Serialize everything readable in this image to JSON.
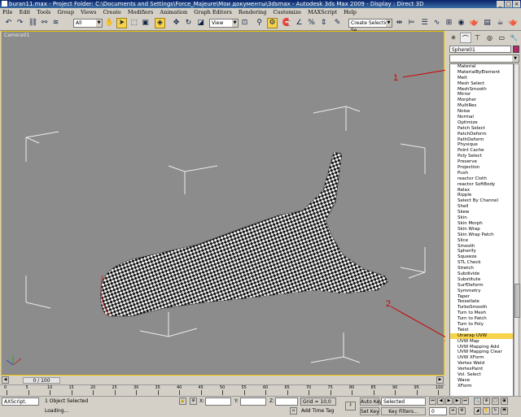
{
  "window": {
    "title": "buran11.max   - Project Folder: C:\\Documents and Settings\\Force_Majeure\\Мои документы\\3dsmax   - Autodesk 3ds Max  2009      - Display : Direct 3D",
    "controls": [
      "_",
      "□",
      "×"
    ]
  },
  "menu": [
    "File",
    "Edit",
    "Tools",
    "Group",
    "Views",
    "Create",
    "Modifiers",
    "Animation",
    "Graph Editors",
    "Rendering",
    "Customize",
    "MAXScript",
    "Help"
  ],
  "toolbar": {
    "selection_filter": "All",
    "reference_coord": "View",
    "named_selection_placeholder": "Create Selection Se"
  },
  "viewport": {
    "label": "Camera01",
    "callouts": [
      "1",
      "2"
    ],
    "colors": {
      "background": "#8c8c8c",
      "active_border": "#e8c000",
      "annotation": "#cc0000"
    }
  },
  "command_panel": {
    "tabs": [
      "create-icon",
      "modify-icon",
      "hierarchy-icon",
      "motion-icon",
      "display-icon",
      "utilities-icon"
    ],
    "object_name": "Sphere01",
    "object_color": "#b0286a",
    "modifiers": [
      "Material",
      "MaterialByElement",
      "Melt",
      "Mesh Select",
      "MeshSmooth",
      "Mirror",
      "Morpher",
      "MultiRes",
      "Noise",
      "Normal",
      "Optimize",
      "Patch Select",
      "PatchDeform",
      "PathDeform",
      "Physique",
      "Point Cache",
      "Poly Select",
      "Preserve",
      "Projection",
      "Push",
      "reactor Cloth",
      "reactor SoftBody",
      "Relax",
      "Ripple",
      "Select By Channel",
      "Shell",
      "Skew",
      "Skin",
      "Skin Morph",
      "Skin Wrap",
      "Skin Wrap Patch",
      "Slice",
      "Smooth",
      "Spherify",
      "Squeeze",
      "STL Check",
      "Stretch",
      "Subdivide",
      "Substitute",
      "SurfDeform",
      "Symmetry",
      "Taper",
      "Tessellate",
      "TurboSmooth",
      "Turn to Mesh",
      "Turn to Patch",
      "Turn to Poly",
      "Twist",
      "Unwrap UVW",
      "UVW Map",
      "UVW Mapping Add",
      "UVW Mapping Clear",
      "UVW XForm",
      "Vertex Weld",
      "VertexPaint",
      "Vol. Select",
      "Wave",
      "XForm"
    ],
    "selected_modifier": "Unwrap UVW"
  },
  "timeline": {
    "slider": "0 / 100",
    "ticks": [
      "0",
      "5",
      "10",
      "15",
      "20",
      "25",
      "30",
      "35",
      "40",
      "45",
      "50",
      "55",
      "60",
      "65",
      "70",
      "75",
      "80",
      "85",
      "90",
      "95",
      "100"
    ]
  },
  "status": {
    "maxscript": "AXScript.",
    "selected": "1 Object Selected",
    "prompt": "Loading...",
    "x_label": "X:",
    "y_label": "Y:",
    "z_label": "Z:",
    "grid": "Grid = 10,0",
    "add_time_tag": "Add Time Tag",
    "auto_key": "Auto Key",
    "set_key": "Set Key",
    "key_mode": "Selected",
    "key_filters": "Key Filters...",
    "frame": "0"
  }
}
